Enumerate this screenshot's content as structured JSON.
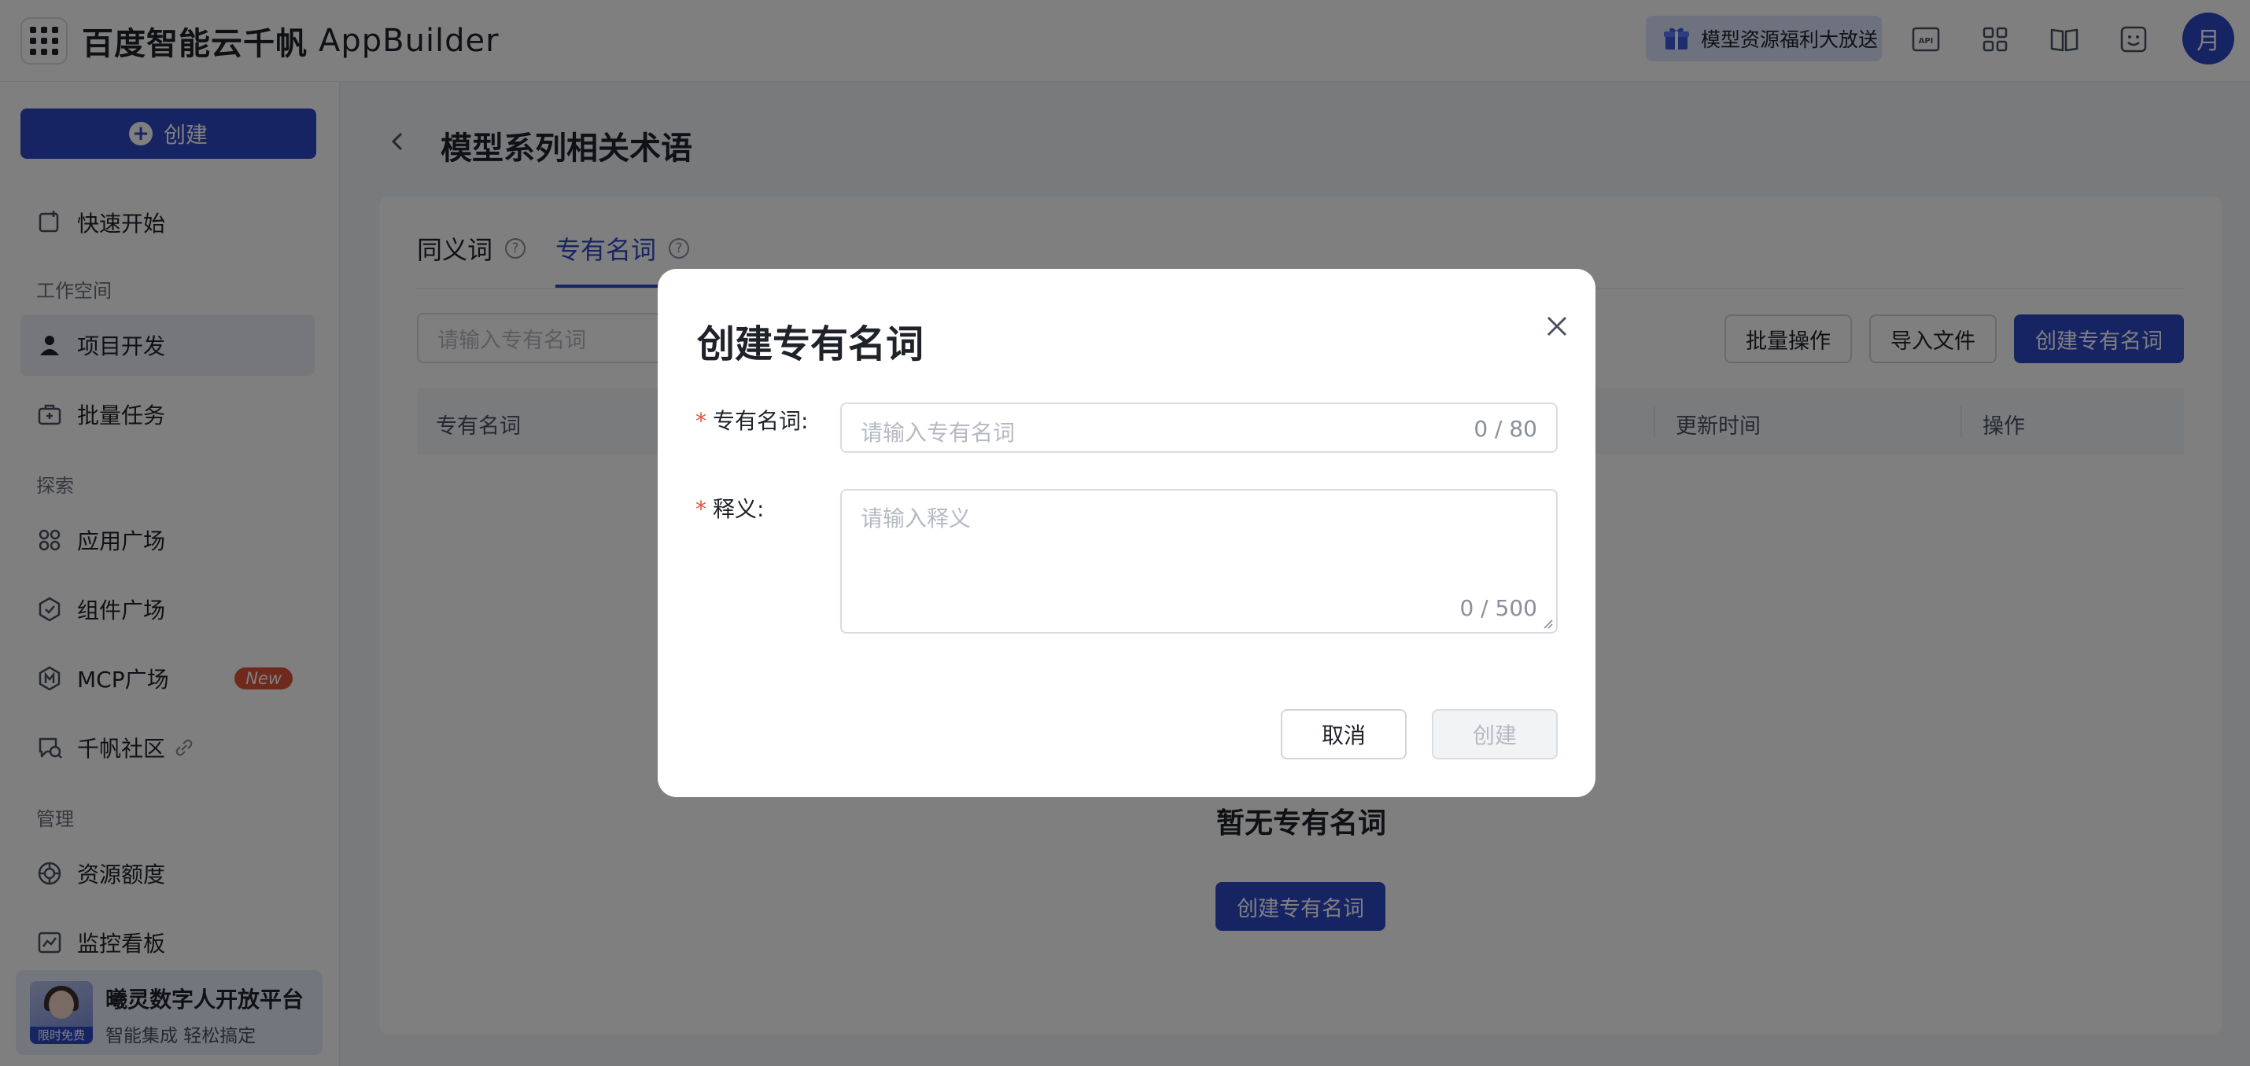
{
  "topbar": {
    "brand_name": "百度智能云千帆",
    "brand_product": "AppBuilder",
    "promo_label": "模型资源福利大放送",
    "avatar_text": "月",
    "icons": [
      "app-grid-icon",
      "api-icon",
      "apps-icon",
      "docs-icon",
      "feedback-icon"
    ]
  },
  "sidebar": {
    "create_label": "创建",
    "quickstart_label": "快速开始",
    "section_workspace": "工作空间",
    "item_project": "项目开发",
    "item_batch": "批量任务",
    "section_explore": "探索",
    "item_app_square": "应用广场",
    "item_component_square": "组件广场",
    "item_mcp_square": "MCP广场",
    "mcp_badge": "New",
    "item_community": "千帆社区",
    "section_manage": "管理",
    "item_quota": "资源额度",
    "item_monitor": "监控看板",
    "promo_title": "曦灵数字人开放平台",
    "promo_sub": "智能集成 轻松搞定",
    "promo_tag": "限时免费"
  },
  "main": {
    "page_title": "模型系列相关术语",
    "tabs": [
      {
        "label": "同义词",
        "active": false
      },
      {
        "label": "专有名词",
        "active": true
      }
    ],
    "search_placeholder": "请输入专有名词",
    "btn_batch": "批量操作",
    "btn_import": "导入文件",
    "btn_create": "创建专有名词",
    "columns": [
      "专有名词",
      "更新时间",
      "操作"
    ],
    "empty_title": "暂无专有名词",
    "empty_button": "创建专有名词"
  },
  "modal": {
    "title": "创建专有名词",
    "term_label": "专有名词:",
    "term_placeholder": "请输入专有名词",
    "term_count": "0 / 80",
    "def_label": "释义:",
    "def_placeholder": "请输入释义",
    "def_count": "0 / 500",
    "required_mark": "*",
    "cancel_label": "取消",
    "create_label": "创建"
  },
  "colors": {
    "primary": "#2f49c9",
    "danger": "#e0523a",
    "overlay": "rgba(0,0,0,0.5)"
  }
}
